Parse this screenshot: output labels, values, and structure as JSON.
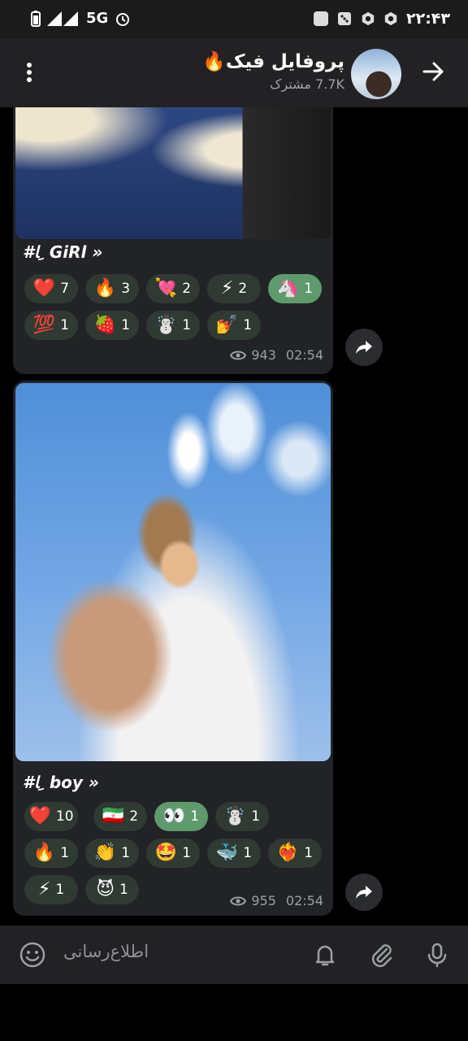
{
  "status_bar": {
    "signal": "5G",
    "time": "۲۲:۴۳"
  },
  "header": {
    "title": "پروفایل فیک🔥",
    "subtitle": "7.7K مشترک"
  },
  "post1": {
    "caption": "#ﺎ ِ GiRl »",
    "reactions": [
      {
        "emoji": "❤️",
        "count": "7",
        "selected": false
      },
      {
        "emoji": "🔥",
        "count": "3",
        "selected": false
      },
      {
        "emoji": "💘",
        "count": "2",
        "selected": false
      },
      {
        "emoji": "⚡",
        "count": "2",
        "selected": false
      },
      {
        "emoji": "🦄",
        "count": "1",
        "selected": true
      },
      {
        "emoji": "💯",
        "count": "1",
        "selected": false
      },
      {
        "emoji": "🍓",
        "count": "1",
        "selected": false
      },
      {
        "emoji": "☃️",
        "count": "1",
        "selected": false
      },
      {
        "emoji": "💅",
        "count": "1",
        "selected": false
      }
    ],
    "views": "943",
    "time": "02:54"
  },
  "post2": {
    "caption": "#ﺎ ِ boy »",
    "reactions": [
      {
        "emoji": "❤️",
        "count": "10",
        "selected": false
      },
      {
        "emoji": "🇮🇷",
        "count": "2",
        "selected": false
      },
      {
        "emoji": "👀",
        "count": "1",
        "selected": true
      },
      {
        "emoji": "☃️",
        "count": "1",
        "selected": false
      },
      {
        "emoji": "🔥",
        "count": "1",
        "selected": false
      },
      {
        "emoji": "👏",
        "count": "1",
        "selected": false
      },
      {
        "emoji": "🤩",
        "count": "1",
        "selected": false
      },
      {
        "emoji": "🐳",
        "count": "1",
        "selected": false
      },
      {
        "emoji": "❤️‍🔥",
        "count": "1",
        "selected": false
      },
      {
        "emoji": "⚡",
        "count": "1",
        "selected": false
      },
      {
        "emoji": "😈",
        "count": "1",
        "selected": false
      }
    ],
    "views": "955",
    "time": "02:54"
  },
  "input": {
    "placeholder": "اطلاع‌رسانی"
  }
}
